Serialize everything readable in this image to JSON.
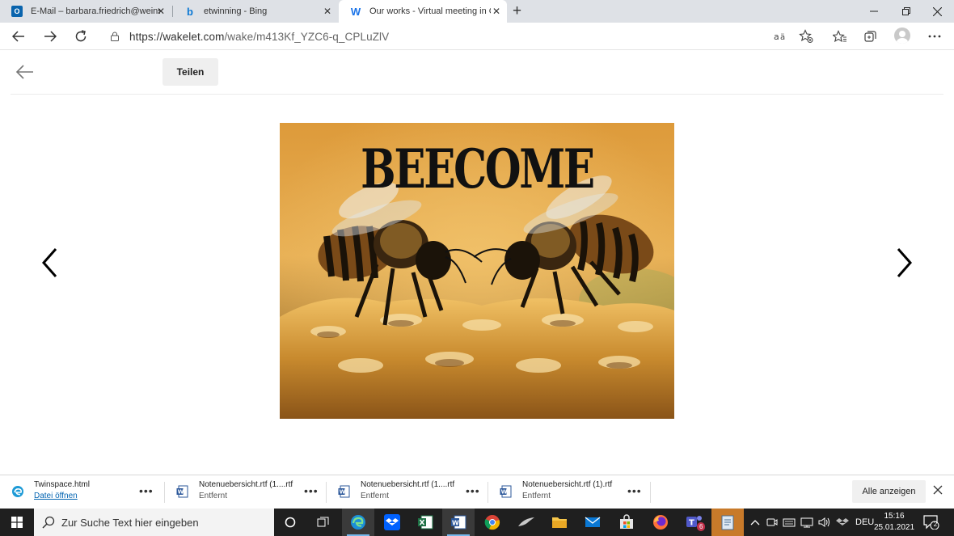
{
  "browser": {
    "tabs": [
      {
        "title": "E-Mail – barbara.friedrich@weinsberg...",
        "icon": "outlook-icon",
        "active": false
      },
      {
        "title": "etwinning - Bing",
        "icon": "bing-icon",
        "active": false
      },
      {
        "title": "Our works - Virtual meeting in C...",
        "icon": "wakelet-icon",
        "active": true
      }
    ],
    "close_glyph": "✕",
    "new_tab_glyph": "+",
    "url_host": "https://wakelet.com",
    "url_path": "/wake/m413Kf_YZC6-q_CPLuZlV"
  },
  "page": {
    "share_label": "Teilen",
    "image_title": "BEECOME"
  },
  "downloads": {
    "items": [
      {
        "name": "Twinspace.html",
        "status": "Datei öffnen",
        "icon": "edge-file-icon"
      },
      {
        "name": "Notenuebersicht.rtf (1....rtf",
        "status": "Entfernt",
        "icon": "word-file-icon"
      },
      {
        "name": "Notenuebersicht.rtf (1....rtf",
        "status": "Entfernt",
        "icon": "word-file-icon"
      },
      {
        "name": "Notenuebersicht.rtf (1).rtf",
        "status": "Entfernt",
        "icon": "word-file-icon"
      }
    ],
    "more_glyph": "•••",
    "show_all_label": "Alle anzeigen"
  },
  "taskbar": {
    "search_placeholder": "Zur Suche Text hier eingeben",
    "language": "DEU",
    "time": "15:16",
    "date": "25.01.2021",
    "teams_badge": "6",
    "notification_count": "2"
  },
  "colors": {
    "tabstrip": "#dee1e6",
    "taskbar": "#1f1f1f",
    "link": "#0063b1",
    "honey": "#e6a53a"
  }
}
